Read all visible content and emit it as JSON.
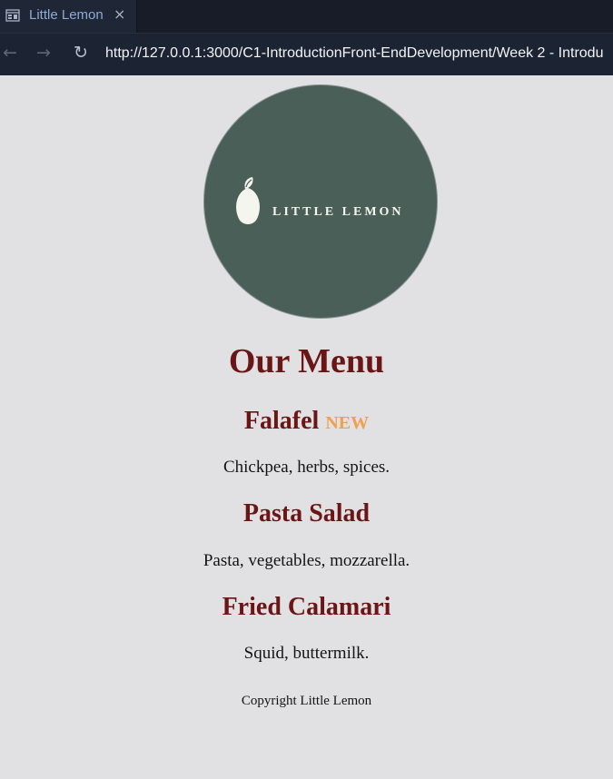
{
  "tab": {
    "title": "Little Lemon",
    "close_glyph": "×",
    "icon": "browser-page-icon"
  },
  "nav": {
    "back_glyph": "←",
    "forward_glyph": "→",
    "reload_glyph": "↻",
    "url": "http://127.0.0.1:3000/C1-IntroductionFront-EndDevelopment/Week 2 - Introdu"
  },
  "logo": {
    "text": "LITTLE LEMON",
    "icon": "lemon-icon",
    "background": "#4a5f57"
  },
  "page": {
    "title": "Our Menu",
    "items": [
      {
        "name": "Falafel",
        "badge": "NEW",
        "description": "Chickpea, herbs, spices."
      },
      {
        "name": "Pasta Salad",
        "description": "Pasta, vegetables, mozzarella."
      },
      {
        "name": "Fried Calamari",
        "description": "Squid, buttermilk."
      }
    ],
    "footer": "Copyright Little Lemon"
  },
  "colors": {
    "heading": "#6b1616",
    "badge": "#f0a04a",
    "page_bg": "#e1e0e2",
    "chrome_bg": "#1c2333"
  }
}
